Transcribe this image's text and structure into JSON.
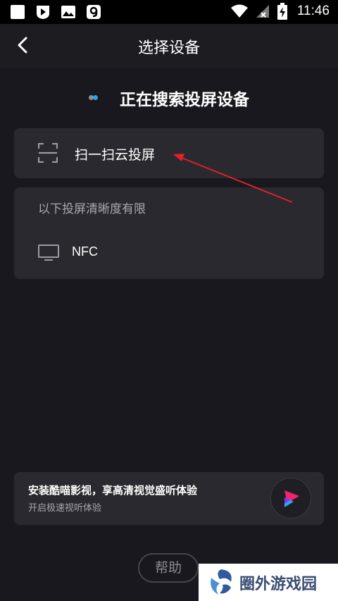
{
  "status_bar": {
    "time": "11:46"
  },
  "header": {
    "title": "选择设备"
  },
  "search": {
    "status": "正在搜索投屏设备"
  },
  "scan_card": {
    "label": "扫一扫云投屏"
  },
  "limited_section": {
    "header": "以下投屏清晰度有限",
    "devices": [
      {
        "name": "NFC",
        "icon": "tv-icon"
      }
    ]
  },
  "promo": {
    "title": "安装酷喵影视，享高清视觉盛听体验",
    "subtitle": "开启极速视听体验"
  },
  "help_button": {
    "label": "帮助"
  },
  "watermark": {
    "text": "圈外游戏园"
  },
  "colors": {
    "background": "#19181e",
    "card": "#2a292f",
    "accent_blue": "#29a4e8",
    "annotation_arrow": "#e0202a"
  }
}
